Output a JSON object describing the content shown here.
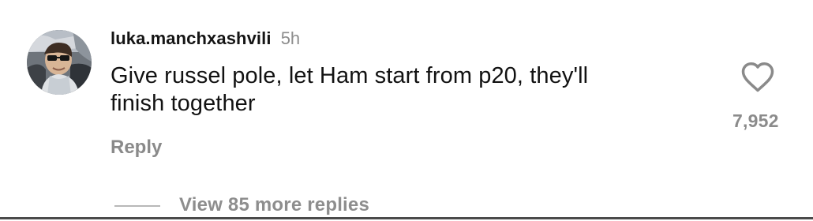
{
  "comment": {
    "username": "luka.manchxashvili",
    "timestamp": "5h",
    "text": "Give russel pole, let Ham start from p20, they'll\nfinish together",
    "reply_label": "Reply",
    "like_icon": "heart-icon",
    "like_count": "7,952",
    "view_replies_label": "View 85 more replies",
    "avatar_icon": "avatar"
  },
  "colors": {
    "text_primary": "#111111",
    "text_secondary": "#8d8d8d",
    "divider": "#b8b8b8",
    "background": "#ffffff"
  }
}
